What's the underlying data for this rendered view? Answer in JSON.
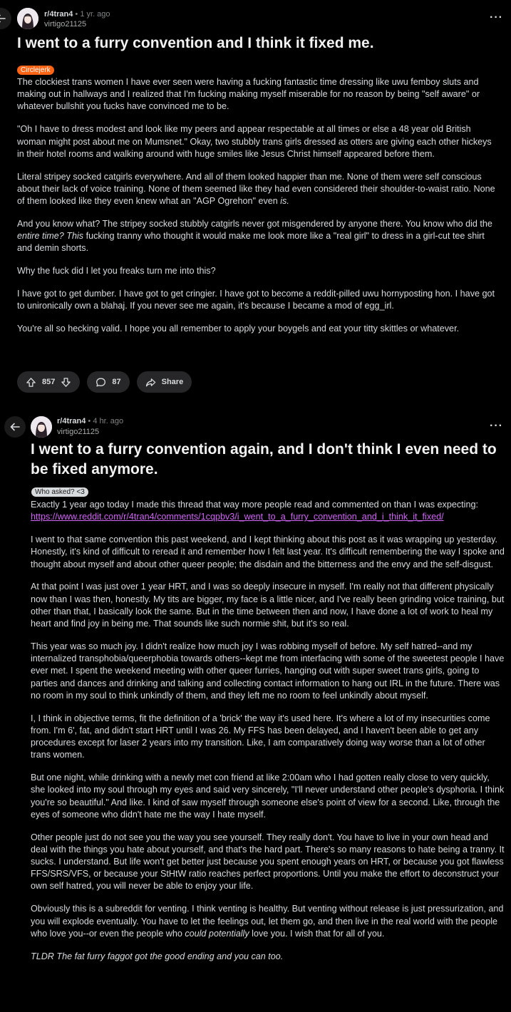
{
  "posts": [
    {
      "subreddit": "r/4tran4",
      "separator": "•",
      "age": "1 yr. ago",
      "username": "virtigo21125",
      "more_icon": "ellipsis-icon",
      "title": "I went to a furry convention and I think it fixed me.",
      "flair": "Circlejerk",
      "flair_color": "#ff6314",
      "paragraphs": [
        "The clockiest trans women I have ever seen were having a fucking fantastic time dressing like uwu femboy sluts and making out in hallways and I realized that I'm fucking making myself miserable for no reason by being \"self aware\" or whatever bullshit you fucks have convinced me to be.",
        "\"Oh I have to dress modest and look like my peers and appear respectable at all times or else a 48 year old British woman might post about me on Mumsnet.\" Okay, two stubbly trans girls dressed as otters are giving each other hickeys in their hotel rooms and walking around with huge smiles like Jesus Christ himself appeared before them.",
        "Literal stripey socked catgirls everywhere. And all of them looked happier than me. None of them were self conscious about their lack of voice training. None of them seemed like they had even considered their shoulder-to-waist ratio. None of them looked like they even knew what an \"AGP Ogrehon\" even is.",
        "And you know what? The stripey socked stubbly catgirls never got misgendered by anyone there. You know who did the entire time? This fucking tranny who thought it would make me look more like a \"real girl\" to dress in a girl-cut tee shirt and demin shorts.",
        "Why the fuck did I let you freaks turn me into this?",
        "I have got to get dumber. I have got to get cringier. I have got to become a reddit-pilled uwu hornyposting hon. I have got to unironically own a blahaj. If you never see me again, it's because I became a mod of egg_irl.",
        "You're all so hecking valid. I hope you all remember to apply your boygels and eat your titty skittles or whatever."
      ],
      "votes": "857",
      "comments": "87",
      "share_label": "Share"
    },
    {
      "subreddit": "r/4tran4",
      "separator": "•",
      "age": "4 hr. ago",
      "username": "virtigo21125",
      "more_icon": "ellipsis-icon",
      "title": "I went to a furry convention again, and I don't think I even need to be fixed anymore.",
      "flair": "Who asked? <3",
      "flair_color": "#d7dadc",
      "intro": "Exactly 1 year ago today I made this thread that way more people read and commented on than I was expecting:",
      "link": "https://www.reddit.com/r/4tran4/comments/1cqpbv3/i_went_to_a_furry_convention_and_i_think_it_fixed/",
      "paragraphs": [
        "I went to that same convention this past weekend, and I kept thinking about this post as it was wrapping up yesterday. Honestly, it's kind of difficult to reread it and remember how I felt last year. It's difficult remembering the way I spoke and thought about myself and about other queer people; the disdain and the bitterness and the envy and the self-disgust.",
        "At that point I was just over 1 year HRT, and I was so deeply insecure in myself. I'm really not that different physically now than I was then, honestly. My tits are bigger, my face is a little nicer, and I've really been grinding voice training, but other than that, I basically look the same. But in the time between then and now, I have done a lot of work to heal my heart and find joy in being me. That sounds like such normie shit, but it's so real.",
        "This year was so much joy. I didn't realize how much joy I was robbing myself of before. My self hatred--and my internalized transphobia/queerphobia towards others--kept me from interfacing with some of the sweetest people I have ever met. I spent the weekend meeting with other queer furries, hanging out with super sweet trans girls, going to parties and dances and drinking and talking and collecting contact information to hang out IRL in the future. There was no room in my soul to think unkindly of them, and they left me no room to feel unkindly about myself.",
        "I, I think in objective terms, fit the definition of a 'brick' the way it's used here. It's where a lot of my insecurities come from. I'm 6', fat, and didn't start HRT until I was 26. My FFS has been delayed, and I haven't been able to get any procedures except for laser 2 years into my transition. Like, I am comparatively doing way worse than a lot of other trans women.",
        "But one night, while drinking with a newly met con friend at like 2:00am who I had gotten really close to very quickly, she looked into my soul through my eyes and said very sincerely, \"I'll never understand other people's dysphoria. I think you're so beautiful.\" And like. I kind of saw myself through someone else's point of view for a second. Like, through the eyes of someone who didn't hate me the way I hate myself.",
        "Other people just do not see you the way you see yourself. They really don't. You have to live in your own head and deal with the things you hate about yourself, and that's the hard part. There's so many reasons to hate being a tranny. It sucks. I understand. But life won't get better just because you spent enough years on HRT, or because you got flawless FFS/SRS/VFS, or because your StHtW ratio reaches perfect proportions. Until you make the effort to deconstruct your own self hatred, you will never be able to enjoy your life.",
        "Obviously this is a subreddit for venting. I think venting is healthy. But venting without release is just pressurization, and you will explode eventually. You have to let the feelings out, let them go, and then live in the real world with the people who love you--or even the people who could potentially love you. I wish that for all of you.",
        "TLDR The fat furry faggot got the good ending and you can too."
      ]
    }
  ],
  "colors": {
    "background": "#000000",
    "text": "#d7dadc",
    "meta": "#818384",
    "link": "#d064f5",
    "pill": "#272729"
  }
}
